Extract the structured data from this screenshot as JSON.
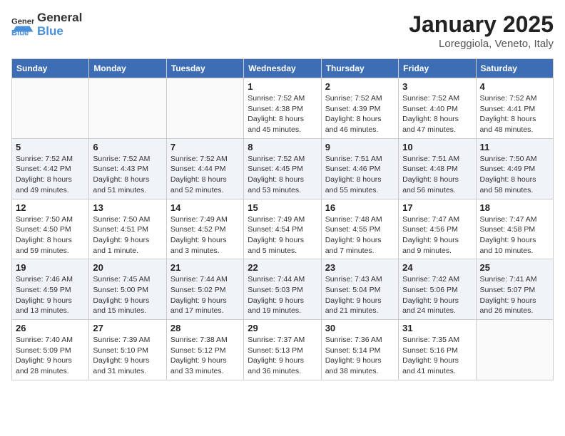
{
  "header": {
    "logo_general": "General",
    "logo_blue": "Blue",
    "month": "January 2025",
    "location": "Loreggiola, Veneto, Italy"
  },
  "weekdays": [
    "Sunday",
    "Monday",
    "Tuesday",
    "Wednesday",
    "Thursday",
    "Friday",
    "Saturday"
  ],
  "weeks": [
    [
      {
        "day": "",
        "info": ""
      },
      {
        "day": "",
        "info": ""
      },
      {
        "day": "",
        "info": ""
      },
      {
        "day": "1",
        "info": "Sunrise: 7:52 AM\nSunset: 4:38 PM\nDaylight: 8 hours\nand 45 minutes."
      },
      {
        "day": "2",
        "info": "Sunrise: 7:52 AM\nSunset: 4:39 PM\nDaylight: 8 hours\nand 46 minutes."
      },
      {
        "day": "3",
        "info": "Sunrise: 7:52 AM\nSunset: 4:40 PM\nDaylight: 8 hours\nand 47 minutes."
      },
      {
        "day": "4",
        "info": "Sunrise: 7:52 AM\nSunset: 4:41 PM\nDaylight: 8 hours\nand 48 minutes."
      }
    ],
    [
      {
        "day": "5",
        "info": "Sunrise: 7:52 AM\nSunset: 4:42 PM\nDaylight: 8 hours\nand 49 minutes."
      },
      {
        "day": "6",
        "info": "Sunrise: 7:52 AM\nSunset: 4:43 PM\nDaylight: 8 hours\nand 51 minutes."
      },
      {
        "day": "7",
        "info": "Sunrise: 7:52 AM\nSunset: 4:44 PM\nDaylight: 8 hours\nand 52 minutes."
      },
      {
        "day": "8",
        "info": "Sunrise: 7:52 AM\nSunset: 4:45 PM\nDaylight: 8 hours\nand 53 minutes."
      },
      {
        "day": "9",
        "info": "Sunrise: 7:51 AM\nSunset: 4:46 PM\nDaylight: 8 hours\nand 55 minutes."
      },
      {
        "day": "10",
        "info": "Sunrise: 7:51 AM\nSunset: 4:48 PM\nDaylight: 8 hours\nand 56 minutes."
      },
      {
        "day": "11",
        "info": "Sunrise: 7:50 AM\nSunset: 4:49 PM\nDaylight: 8 hours\nand 58 minutes."
      }
    ],
    [
      {
        "day": "12",
        "info": "Sunrise: 7:50 AM\nSunset: 4:50 PM\nDaylight: 8 hours\nand 59 minutes."
      },
      {
        "day": "13",
        "info": "Sunrise: 7:50 AM\nSunset: 4:51 PM\nDaylight: 9 hours\nand 1 minute."
      },
      {
        "day": "14",
        "info": "Sunrise: 7:49 AM\nSunset: 4:52 PM\nDaylight: 9 hours\nand 3 minutes."
      },
      {
        "day": "15",
        "info": "Sunrise: 7:49 AM\nSunset: 4:54 PM\nDaylight: 9 hours\nand 5 minutes."
      },
      {
        "day": "16",
        "info": "Sunrise: 7:48 AM\nSunset: 4:55 PM\nDaylight: 9 hours\nand 7 minutes."
      },
      {
        "day": "17",
        "info": "Sunrise: 7:47 AM\nSunset: 4:56 PM\nDaylight: 9 hours\nand 9 minutes."
      },
      {
        "day": "18",
        "info": "Sunrise: 7:47 AM\nSunset: 4:58 PM\nDaylight: 9 hours\nand 10 minutes."
      }
    ],
    [
      {
        "day": "19",
        "info": "Sunrise: 7:46 AM\nSunset: 4:59 PM\nDaylight: 9 hours\nand 13 minutes."
      },
      {
        "day": "20",
        "info": "Sunrise: 7:45 AM\nSunset: 5:00 PM\nDaylight: 9 hours\nand 15 minutes."
      },
      {
        "day": "21",
        "info": "Sunrise: 7:44 AM\nSunset: 5:02 PM\nDaylight: 9 hours\nand 17 minutes."
      },
      {
        "day": "22",
        "info": "Sunrise: 7:44 AM\nSunset: 5:03 PM\nDaylight: 9 hours\nand 19 minutes."
      },
      {
        "day": "23",
        "info": "Sunrise: 7:43 AM\nSunset: 5:04 PM\nDaylight: 9 hours\nand 21 minutes."
      },
      {
        "day": "24",
        "info": "Sunrise: 7:42 AM\nSunset: 5:06 PM\nDaylight: 9 hours\nand 24 minutes."
      },
      {
        "day": "25",
        "info": "Sunrise: 7:41 AM\nSunset: 5:07 PM\nDaylight: 9 hours\nand 26 minutes."
      }
    ],
    [
      {
        "day": "26",
        "info": "Sunrise: 7:40 AM\nSunset: 5:09 PM\nDaylight: 9 hours\nand 28 minutes."
      },
      {
        "day": "27",
        "info": "Sunrise: 7:39 AM\nSunset: 5:10 PM\nDaylight: 9 hours\nand 31 minutes."
      },
      {
        "day": "28",
        "info": "Sunrise: 7:38 AM\nSunset: 5:12 PM\nDaylight: 9 hours\nand 33 minutes."
      },
      {
        "day": "29",
        "info": "Sunrise: 7:37 AM\nSunset: 5:13 PM\nDaylight: 9 hours\nand 36 minutes."
      },
      {
        "day": "30",
        "info": "Sunrise: 7:36 AM\nSunset: 5:14 PM\nDaylight: 9 hours\nand 38 minutes."
      },
      {
        "day": "31",
        "info": "Sunrise: 7:35 AM\nSunset: 5:16 PM\nDaylight: 9 hours\nand 41 minutes."
      },
      {
        "day": "",
        "info": ""
      }
    ]
  ]
}
